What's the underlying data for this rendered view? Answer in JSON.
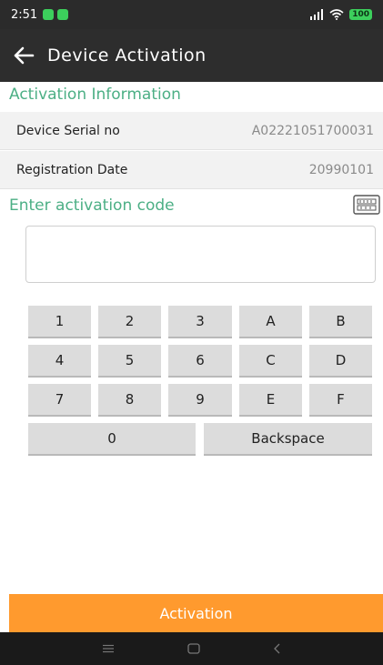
{
  "status_bar": {
    "time": "2:51",
    "battery": "100"
  },
  "app_bar": {
    "title": "Device Activation"
  },
  "activation_info": {
    "heading": "Activation Information",
    "rows": [
      {
        "label": "Device Serial no",
        "value": "A02221051700031"
      },
      {
        "label": "Registration Date",
        "value": "20990101"
      }
    ]
  },
  "activation_code": {
    "heading": "Enter activation code",
    "value": "",
    "placeholder": ""
  },
  "keypad": {
    "keys": [
      "1",
      "2",
      "3",
      "A",
      "B",
      "4",
      "5",
      "6",
      "C",
      "D",
      "7",
      "8",
      "9",
      "E",
      "F"
    ],
    "zero": "0",
    "backspace": "Backspace"
  },
  "activation_button": {
    "label": "Activation"
  },
  "colors": {
    "accent_green": "#4caf85",
    "button_orange": "#ff9a2e",
    "app_bar": "#2d2d2d"
  }
}
